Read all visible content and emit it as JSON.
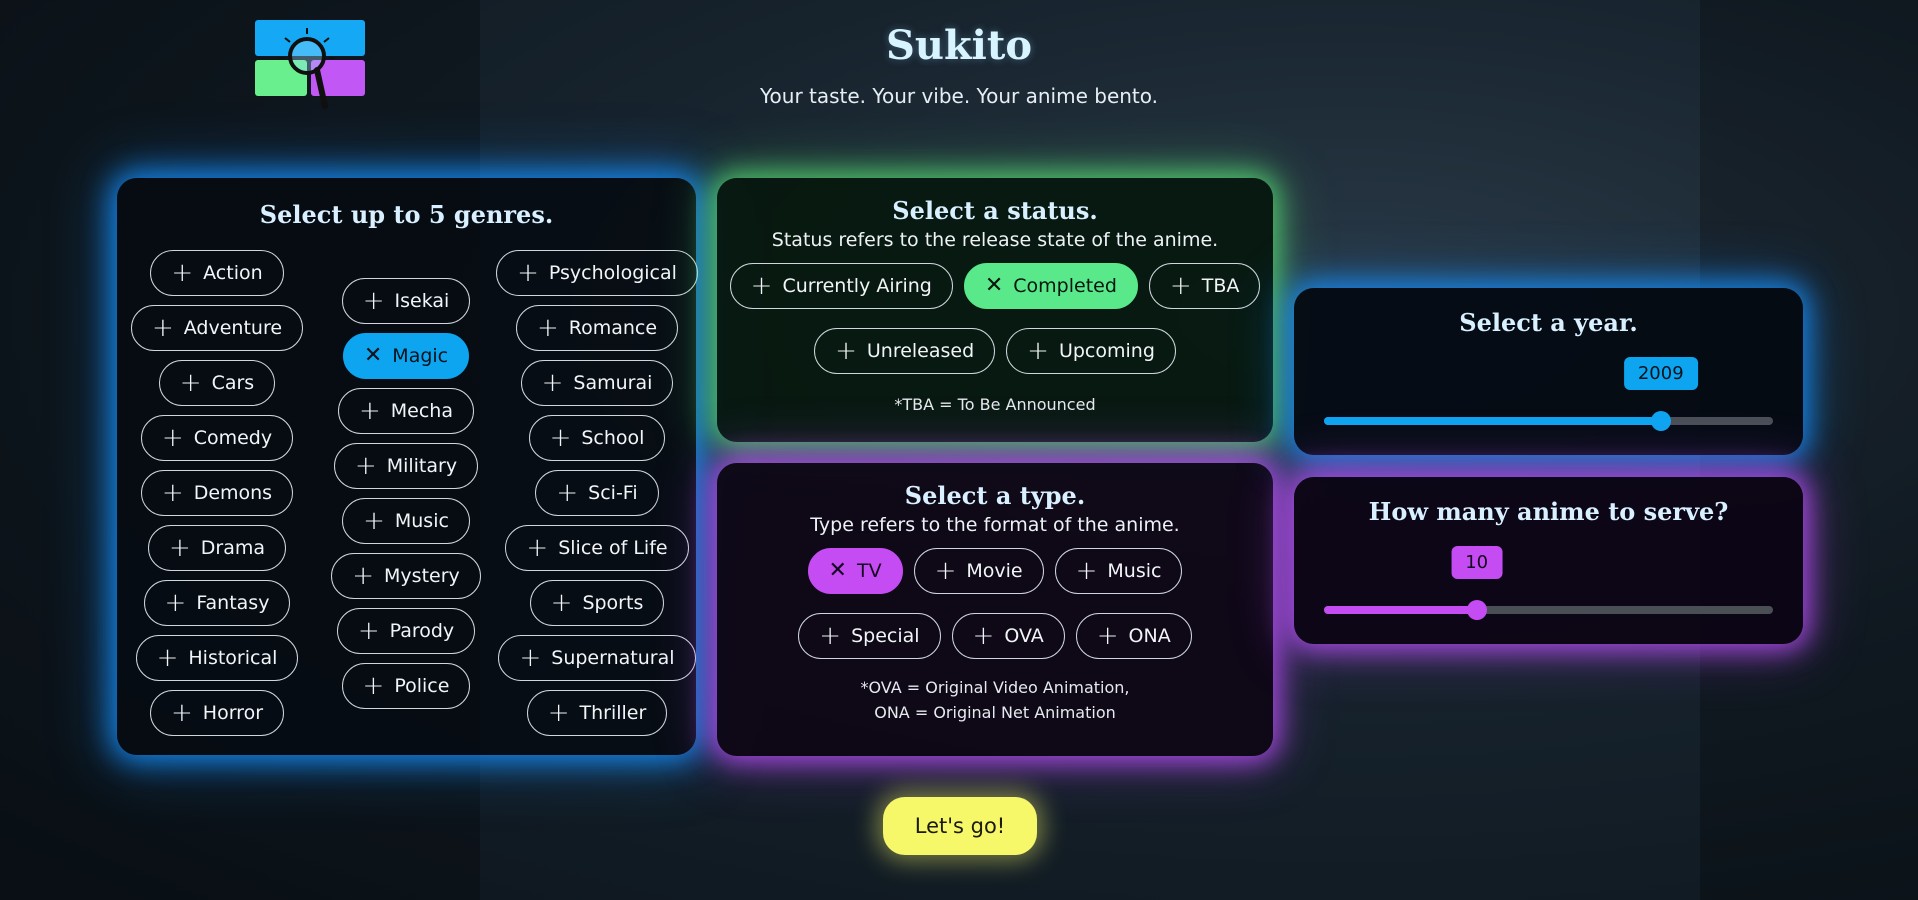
{
  "header": {
    "title": "Sukito",
    "tagline": "Your taste. Your vibe. Your anime bento."
  },
  "genres": {
    "title": "Select up to 5 genres.",
    "columns": [
      [
        "Action",
        "Adventure",
        "Cars",
        "Comedy",
        "Demons",
        "Drama",
        "Fantasy",
        "Historical",
        "Horror"
      ],
      [
        "Isekai",
        "Magic",
        "Mecha",
        "Military",
        "Music",
        "Mystery",
        "Parody",
        "Police"
      ],
      [
        "Psychological",
        "Romance",
        "Samurai",
        "School",
        "Sci-Fi",
        "Slice of Life",
        "Sports",
        "Supernatural",
        "Thriller"
      ]
    ],
    "selected": [
      "Magic"
    ]
  },
  "status": {
    "title": "Select a status.",
    "subtitle": "Status refers to the release state of the anime.",
    "rows": [
      [
        "Currently Airing",
        "Completed",
        "TBA"
      ],
      [
        "Unreleased",
        "Upcoming"
      ]
    ],
    "selected": "Completed",
    "note": "*TBA = To Be Announced"
  },
  "type": {
    "title": "Select a type.",
    "subtitle": "Type refers to the format of the anime.",
    "rows": [
      [
        "TV",
        "Movie",
        "Music"
      ],
      [
        "Special",
        "OVA",
        "ONA"
      ]
    ],
    "selected": "TV",
    "note_lines": [
      "*OVA = Original Video Animation,",
      "ONA = Original Net Animation"
    ]
  },
  "year": {
    "title": "Select a year.",
    "value": "2009",
    "level": 0.75
  },
  "count": {
    "title": "How many anime to serve?",
    "value": "10",
    "level": 0.34
  },
  "actions": {
    "go_label": "Let's go!"
  },
  "icons": {
    "add": "plus-icon",
    "remove": "x-icon"
  },
  "colors": {
    "blue": "#0ea5f0",
    "green": "#59e88a",
    "purple": "#c44cf2",
    "yellow": "#f7f76a"
  }
}
